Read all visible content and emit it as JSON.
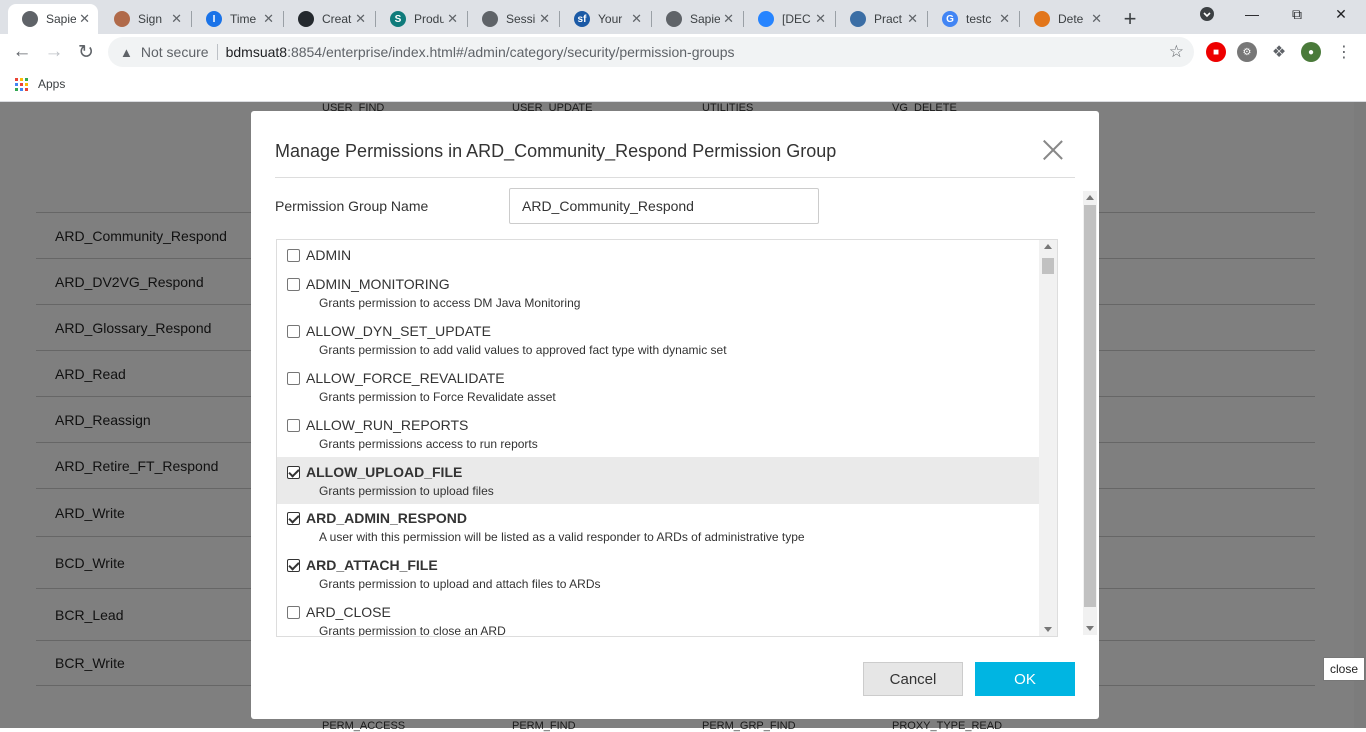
{
  "browser": {
    "tabs": [
      {
        "title": "Sapie",
        "favicon": "globe-icon",
        "color": "#5f6368",
        "active": true
      },
      {
        "title": "Sign",
        "favicon": "avatar-icon",
        "color": "#b06a4a"
      },
      {
        "title": "Time",
        "favicon": "timesheet-icon",
        "color": "#1a73e8",
        "glyph": "I"
      },
      {
        "title": "Creat",
        "favicon": "github-icon",
        "color": "#24292e"
      },
      {
        "title": "Produ",
        "favicon": "sharepoint-icon",
        "color": "#0f7b7b",
        "glyph": "S"
      },
      {
        "title": "Sessi",
        "favicon": "globe-icon",
        "color": "#5f6368"
      },
      {
        "title": "Your",
        "favicon": "salesforce-icon",
        "color": "#1b5aa6",
        "glyph": "sf"
      },
      {
        "title": "Sapie",
        "favicon": "globe-icon",
        "color": "#5f6368"
      },
      {
        "title": "[DEC",
        "favicon": "jira-icon",
        "color": "#2684ff"
      },
      {
        "title": "Pract",
        "favicon": "practice-icon",
        "color": "#3b6ea5"
      },
      {
        "title": "testc",
        "favicon": "google-icon",
        "color": "#4285f4",
        "glyph": "G"
      },
      {
        "title": "Dete",
        "favicon": "metamask-icon",
        "color": "#e2761b"
      }
    ],
    "security_label": "Not secure",
    "url_host": "bdmsuat8",
    "url_path": ":8854/enterprise/index.html#/admin/category/security/permission-groups",
    "bookmarks": {
      "apps_label": "Apps"
    }
  },
  "background": {
    "header_labels": [
      "USER_FIND",
      "USER_UPDATE",
      "UTILITIES",
      "VG_DELETE"
    ],
    "footer_labels": [
      "PERM_ACCESS",
      "PERM_FIND",
      "PERM_GRP_FIND",
      "PROXY_TYPE_READ"
    ],
    "groups": [
      "ARD_Community_Respond",
      "ARD_DV2VG_Respond",
      "ARD_Glossary_Respond",
      "ARD_Read",
      "ARD_Reassign",
      "ARD_Retire_FT_Respond",
      "ARD_Write",
      "BCD_Write",
      "BCR_Lead",
      "BCR_Write"
    ]
  },
  "modal": {
    "title": "Manage Permissions in ARD_Community_Respond Permission Group",
    "name_label": "Permission Group Name",
    "name_value": "ARD_Community_Respond",
    "permissions": [
      {
        "name": "ADMIN",
        "desc": "",
        "checked": false
      },
      {
        "name": "ADMIN_MONITORING",
        "desc": "Grants permission to access DM Java Monitoring",
        "checked": false
      },
      {
        "name": "ALLOW_DYN_SET_UPDATE",
        "desc": "Grants permission to add valid values to approved fact type with dynamic set",
        "checked": false
      },
      {
        "name": "ALLOW_FORCE_REVALIDATE",
        "desc": "Grants permission to Force Revalidate asset",
        "checked": false
      },
      {
        "name": "ALLOW_RUN_REPORTS",
        "desc": "Grants permissions access to run reports",
        "checked": false
      },
      {
        "name": "ALLOW_UPLOAD_FILE",
        "desc": "Grants permission to upload files",
        "checked": true
      },
      {
        "name": "ARD_ADMIN_RESPOND",
        "desc": "A user with this permission will be listed as a valid responder to ARDs of administrative type",
        "checked": true
      },
      {
        "name": "ARD_ATTACH_FILE",
        "desc": "Grants permission to upload and attach files to ARDs",
        "checked": true
      },
      {
        "name": "ARD_CLOSE",
        "desc": "Grants permission to close an ARD",
        "checked": false
      }
    ],
    "cancel_label": "Cancel",
    "ok_label": "OK"
  },
  "tooltip": "close",
  "colors": {
    "ok_button": "#00b5e2",
    "overlay": "rgba(0,0,0,0.5)"
  }
}
